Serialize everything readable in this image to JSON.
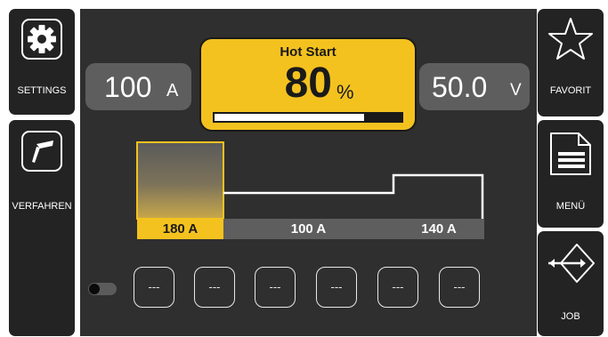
{
  "sidebar_left": {
    "settings_label": "SETTINGS",
    "procedure_label": "VERFAHREN"
  },
  "sidebar_right": {
    "favorite_label": "FAVORIT",
    "menu_label": "MENÜ",
    "job_label": "JOB"
  },
  "current_box": {
    "value": "100",
    "unit": "A"
  },
  "voltage_box": {
    "value": "50.0",
    "unit": "V"
  },
  "parameter": {
    "title": "Hot Start",
    "value": "80",
    "unit": "%",
    "level_percent": 80
  },
  "profile": {
    "segments": [
      {
        "label": "180 A"
      },
      {
        "label": "100 A"
      },
      {
        "label": "140 A"
      }
    ]
  },
  "memory_slots": [
    "---",
    "---",
    "---",
    "---",
    "---",
    "---"
  ],
  "colors": {
    "accent": "#f4c21f",
    "background": "#2f2f2f",
    "button": "#232323",
    "value_box": "#5e5e5e"
  },
  "icons": {
    "settings": "gear-icon",
    "procedure": "welding-torch-icon",
    "favorite": "star-icon",
    "menu": "menu-document-icon",
    "job": "arrow-diamond-icon"
  }
}
